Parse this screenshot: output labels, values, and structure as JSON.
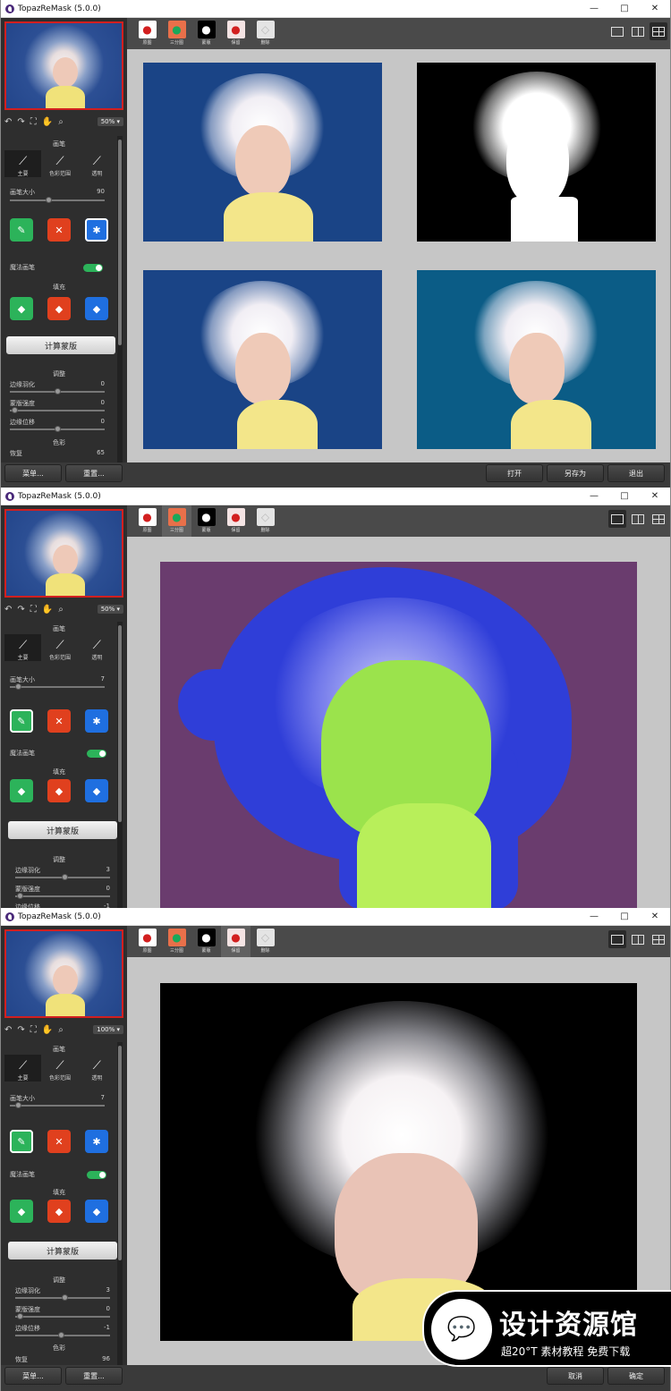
{
  "app": {
    "title": "TopazReMask (5.0.0)",
    "min": "—",
    "max": "□",
    "close": "✕"
  },
  "tabs": [
    {
      "label": "原图"
    },
    {
      "label": "三分图"
    },
    {
      "label": "蒙版"
    },
    {
      "label": "保留"
    },
    {
      "label": "删除"
    }
  ],
  "left": {
    "brush_heading": "画笔",
    "brush_tabs": [
      "主要",
      "色彩范围",
      "透明"
    ],
    "brush_size_label": "画笔大小",
    "magic_brush_label": "魔法画笔",
    "toggle_text": "开",
    "fill_heading": "填充",
    "calc_button": "计算蒙版",
    "adjust_heading": "调整",
    "edge_feather": "边缘羽化",
    "mask_strength": "蒙版强度",
    "edge_shift": "边缘位移",
    "color_heading": "色彩",
    "recover": "恢复"
  },
  "windows": [
    {
      "zoom": "50%",
      "brush_size": "90",
      "edge_feather": "0",
      "mask_strength": "0",
      "edge_shift": "0",
      "recover": "65",
      "bottom_left": [
        "菜单...",
        "重置..."
      ],
      "bottom_right": [
        "打开",
        "另存为",
        "退出"
      ]
    },
    {
      "zoom": "50%",
      "brush_size": "7",
      "edge_feather": "3",
      "mask_strength": "0",
      "edge_shift": "-1"
    },
    {
      "zoom": "100%",
      "brush_size": "7",
      "edge_feather": "3",
      "mask_strength": "0",
      "edge_shift": "-1",
      "recover": "96",
      "bottom_left": [
        "菜单...",
        "重置..."
      ],
      "bottom_right": [
        "取消",
        "确定"
      ]
    }
  ],
  "watermark": {
    "title": "设计资源馆",
    "subtitle": "超20°T 素材教程 免费下载"
  }
}
